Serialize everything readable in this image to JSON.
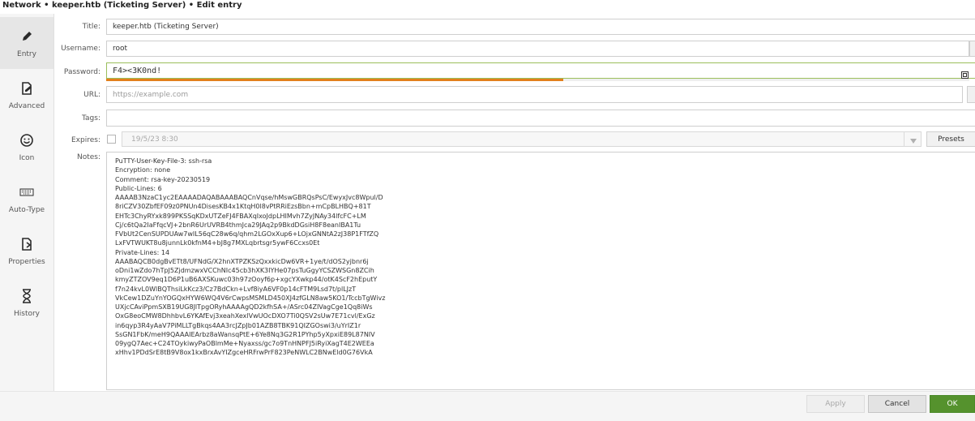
{
  "window": {
    "title": "Network • keeper.htb (Ticketing Server) • Edit entry"
  },
  "sidebar": {
    "items": [
      {
        "label": "Entry",
        "icon": "pencil-icon",
        "active": true
      },
      {
        "label": "Advanced",
        "icon": "document-edit-icon",
        "active": false
      },
      {
        "label": "Icon",
        "icon": "smiley-icon",
        "active": false
      },
      {
        "label": "Auto-Type",
        "icon": "keyboard-icon",
        "active": false
      },
      {
        "label": "Properties",
        "icon": "document-arrow-icon",
        "active": false
      },
      {
        "label": "History",
        "icon": "hourglass-icon",
        "active": false
      }
    ]
  },
  "form": {
    "title": {
      "label": "Title:",
      "value": "keeper.htb (Ticketing Server)"
    },
    "username": {
      "label": "Username:",
      "value": "root"
    },
    "password": {
      "label": "Password:",
      "value": "F4><3K0nd!",
      "strength_percent": 53,
      "strength_color": "#e37f1c"
    },
    "url": {
      "label": "URL:",
      "placeholder": "https://example.com"
    },
    "tags": {
      "label": "Tags:",
      "value": ""
    },
    "expires": {
      "label": "Expires:",
      "checked": false,
      "value": "19/5/23 8:30",
      "presets_label": "Presets"
    },
    "notes": {
      "label": "Notes:",
      "lines": [
        "PuTTY-User-Key-File-3: ssh-rsa",
        "Encryption: none",
        "Comment: rsa-key-20230519",
        "Public-Lines: 6",
        "AAAAB3NzaC1yc2EAAAADAQABAAABAQCnVqse/hMswGBRQsPsC/EwyxJvc8Wpul/D",
        "8riCZV30ZbfEF09z0PNUn4DisesKB4x1KtqH0l8vPtRRiEzsBbn+mCpBLHBQ+81T",
        "EHTc3ChyRYxk899PKSSqKDxUTZeFJ4FBAXqIxoJdpLHIMvh7ZyJNAy34lfcFC+LM",
        "Cj/c6tQa2IaFfqcVJ+2bnR6UrUVRB4thmJca29JAq2p9BkdDGsiH8F8eanIBA1Tu",
        "FVbUt2CenSUPDUAw7wIL56qC28w6q/qhm2LGOxXup6+LOjxGNNtA2zJ38P1FTfZQ",
        "LxFVTWUKT8u8junnLk0kfnM4+bJ8g7MXLqbrtsgr5ywF6Ccxs0Et",
        "Private-Lines: 14",
        "AAABAQCB0dgBvETt8/UFNdG/X2hnXTPZKSzQxxkicDw6VR+1ye/t/dOS2yjbnr6j",
        "oDni1wZdo7hTpJ5ZjdmzwxVCChNIc45cb3hXK3IYHe07psTuGgyYCSZWSGn8ZCih",
        "kmyZTZOV9eq1D6P1uB6AXSKuwc03h97zOoyf6p+xgcYXwkp44/otK4ScF2hEputY",
        "f7n24kvL0WlBQThsiLkKcz3/Cz7BdCkn+Lvf8iyA6VF0p14cFTM9Lsd7t/plLJzT",
        "VkCew1DZuYnYOGQxHYW6WQ4V6rCwpsMSMLD450XJ4zfGLN8aw5KO1/TccbTgWivz",
        "UXjcCAviPpmSXB19UG8JlTpgORyhAAAAgQD2kfhSA+/ASrc04ZIVagCge1Qq8iWs",
        "OxG8eoCMW8DhhbvL6YKAfEvj3xeahXexlVwUOcDXO7Ti0QSV2sUw7E71cvl/ExGz",
        "in6qyp3R4yAaV7PiMLLTgBkqs4AA3rcJZpJb01AZB8TBK91QIZGOswi3/uYrIZ1r",
        "SsGN1FbK/meH9QAAAIEArbz8aWansqPtE+6Ye8Nq3G2R1PYhp5yXpxiE89L87NIV",
        "09ygQ7Aec+C24TOykiwyPaOBlmMe+Nyaxss/gc7o9TnHNPFJ5iRyiXagT4E2WEEa",
        "xHhv1PDdSrE8tB9V8ox1kxBrxAvYIZgceHRFrwPrF823PeNWLC2BNwEld0G76VkA"
      ]
    }
  },
  "buttons": {
    "apply": "Apply",
    "cancel": "Cancel",
    "ok": "OK"
  },
  "colors": {
    "accent": "#55922d",
    "strength": "#e37f1c"
  }
}
